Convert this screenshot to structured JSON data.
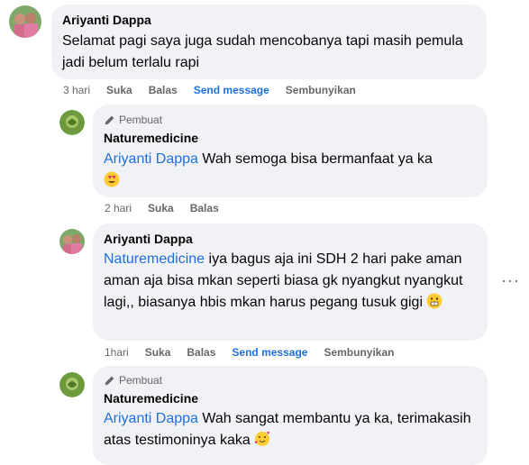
{
  "comments": [
    {
      "author": "Ariyanti Dappa",
      "text": "Selamat pagi saya juga sudah mencobanya tapi masih pemula jadi belum terlalu rapi",
      "time": "3 hari",
      "like": "Suka",
      "reply": "Balas",
      "send": "Send message",
      "hide": "Sembunyikan"
    },
    {
      "badge": "Pembuat",
      "author": "Naturemedicine",
      "mention": "Ariyanti Dappa",
      "text": " Wah semoga bisa bermanfaat ya ka",
      "emoji": "heart-eyes-emoji",
      "time": "2 hari",
      "like": "Suka",
      "reply": "Balas"
    },
    {
      "author": "Ariyanti Dappa",
      "mention": "Naturemedicine",
      "text": " iya bagus aja ini SDH 2 hari pake aman aman aja bisa mkan seperti biasa gk nyangkut nyangkut lagi,, biasanya hbis mkan harus pegang tusuk gigi",
      "emoji": "grimace-emoji",
      "time": "1hari",
      "like": "Suka",
      "reply": "Balas",
      "send": "Send message",
      "hide": "Sembunyikan"
    },
    {
      "badge": "Pembuat",
      "author": "Naturemedicine",
      "mention": "Ariyanti Dappa",
      "text": " Wah sangat membantu ya ka, terimakasih atas testimoninya kaka",
      "emoji": "hearts-face-emoji"
    }
  ],
  "colors": {
    "bubble": "#f0f2f5",
    "mention": "#216fdb",
    "meta": "#65676b"
  }
}
